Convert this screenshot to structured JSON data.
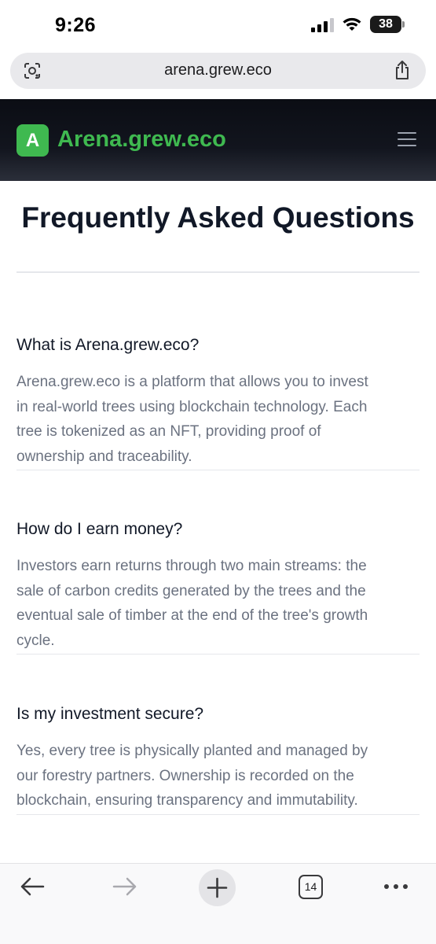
{
  "status_bar": {
    "time": "9:26",
    "battery": "38"
  },
  "browser": {
    "url": "arena.grew.eco",
    "tab_count": "14"
  },
  "header": {
    "logo_letter": "A",
    "site_name": "Arena.grew.eco"
  },
  "main": {
    "title": "Frequently Asked Questions",
    "faqs": [
      {
        "question": "What is Arena.grew.eco?",
        "answer": "Arena.grew.eco is a platform that allows you to invest in real-world trees using blockchain technology. Each tree is tokenized as an NFT, providing proof of ownership and traceability."
      },
      {
        "question": "How do I earn money?",
        "answer": "Investors earn returns through two main streams: the sale of carbon credits generated by the trees and the eventual sale of timber at the end of the tree's growth cycle."
      },
      {
        "question": "Is my investment secure?",
        "answer": "Yes, every tree is physically planted and managed by our forestry partners. Ownership is recorded on the blockchain, ensuring transparency and immutability."
      }
    ]
  },
  "colors": {
    "brand_green": "#3fb950",
    "header_bg": "#0b0d14"
  }
}
